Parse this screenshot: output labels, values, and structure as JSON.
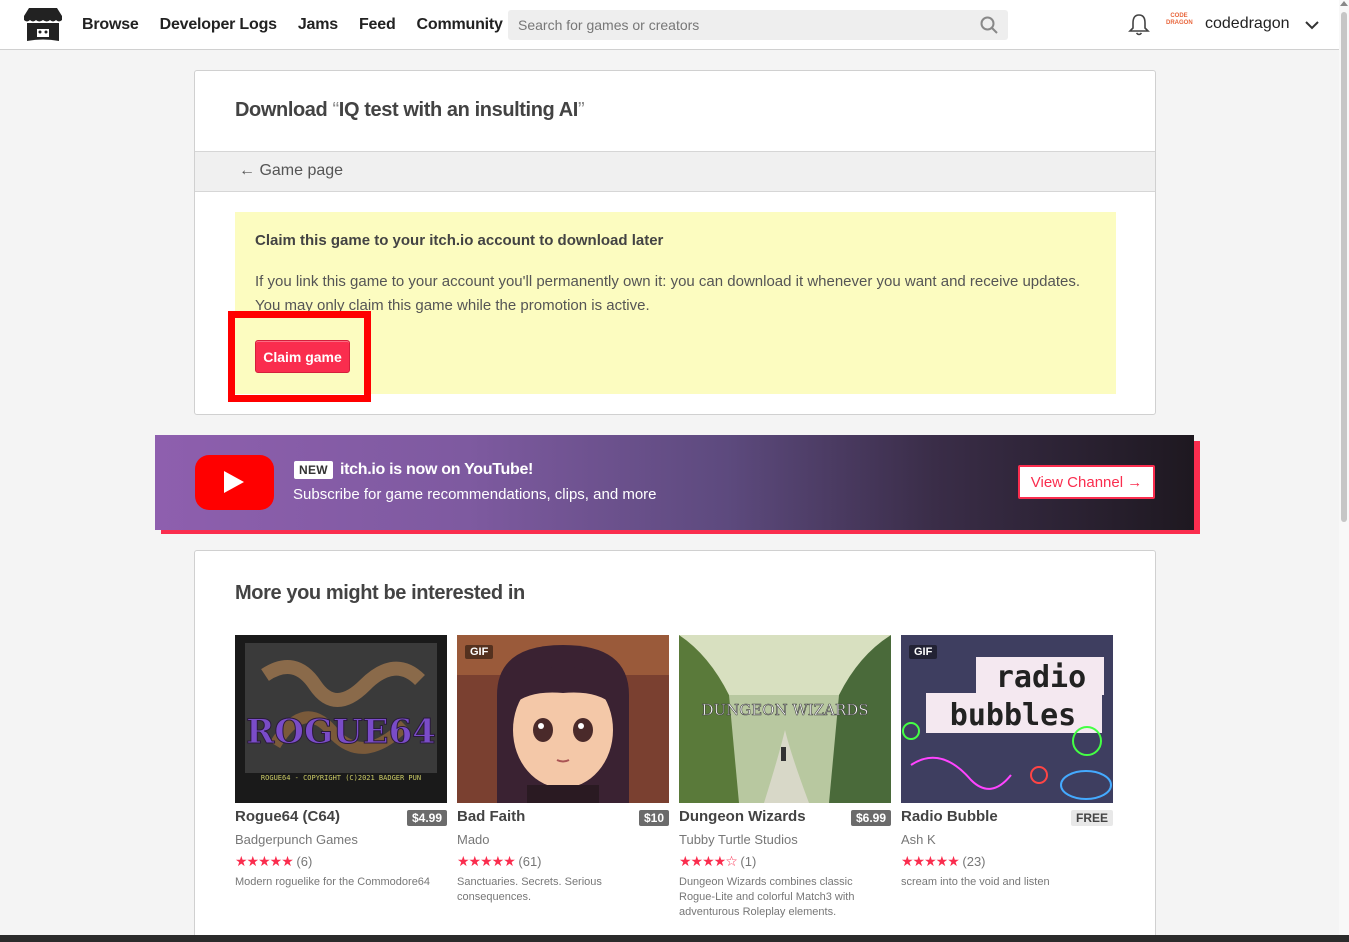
{
  "header": {
    "nav": [
      "Browse",
      "Developer Logs",
      "Jams",
      "Feed",
      "Community"
    ],
    "search_placeholder": "Search for games or creators",
    "username": "codedragon",
    "avatar_text": "CODE DRAGON"
  },
  "download": {
    "title_prefix": "Download ",
    "title_open_quote": "“",
    "game_name": "IQ test with an insulting AI",
    "title_close_quote": "”",
    "back_link": "← Game page",
    "claim_title": "Claim this game to your itch.io account to download later",
    "claim_text": "If you link this game to your account you'll permanently own it: you can download it whenever you want and receive updates. You may only claim this game while the promotion is active.",
    "claim_button": "Claim game"
  },
  "youtube_banner": {
    "new_badge": "NEW",
    "title": "itch.io is now on YouTube!",
    "subtitle": "Subscribe for game recommendations, clips, and more",
    "button": "View Channel →"
  },
  "recommendations": {
    "heading": "More you might be interested in",
    "games": [
      {
        "title": "Rogue64 (C64)",
        "price": "$4.99",
        "author": "Badgerpunch Games",
        "stars": "★★★★★",
        "count": "(6)",
        "desc": "Modern roguelike for the Commodore64",
        "gif": ""
      },
      {
        "title": "Bad Faith",
        "price": "$10",
        "author": "Mado",
        "stars": "★★★★★",
        "count": "(61)",
        "desc": "Sanctuaries. Secrets. Serious consequences.",
        "gif": "GIF"
      },
      {
        "title": "Dungeon Wizards",
        "price": "$6.99",
        "author": "Tubby Turtle Studios",
        "stars": "★★★★☆",
        "count": "(1)",
        "desc": "Dungeon Wizards combines classic Rogue-Lite and colorful Match3 with adventurous Roleplay elements.",
        "gif": ""
      },
      {
        "title": "Radio Bubble",
        "price": "FREE",
        "author": "Ash K",
        "stars": "★★★★★",
        "count": "(23)",
        "desc": "scream into the void and listen",
        "gif": "GIF"
      }
    ]
  },
  "thumb_text": {
    "rogue": "ROGUE64",
    "rogue_copy": "ROGUE64 - COPYRIGHT (C)2021 BADGER PUN",
    "dungeon": "DUNGEON WIZARDS",
    "radio_1": "radio",
    "radio_2": "bubbles"
  }
}
